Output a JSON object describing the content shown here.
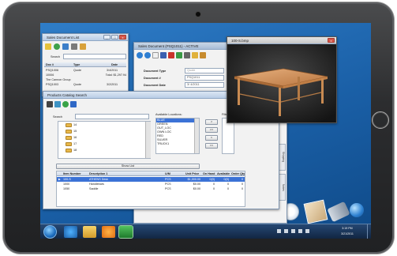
{
  "sales_list": {
    "title": "Sales Document List",
    "search_label": "Search",
    "headers": [
      "Doc #",
      "Type",
      "Date"
    ],
    "rows": [
      {
        "doc": "PSQ1006",
        "type": "Quote",
        "date": "3/4/2011"
      },
      {
        "doc": "10006",
        "type": "",
        "date": "Total: $1,297.94"
      },
      {
        "doc": "The Cannon Group",
        "type": "",
        "date": ""
      },
      {
        "doc": "PSQ1003",
        "type": "Quote",
        "date": "3/2/2011"
      }
    ]
  },
  "sales_doc": {
    "title": "Sales Document (PSQ1011) - ACTIVE",
    "fields": [
      {
        "label": "Document Type",
        "value": "Quote"
      },
      {
        "label": "Document #",
        "value": "PSQ1011"
      },
      {
        "label": "Document Date",
        "value": "3/ 4/2011"
      }
    ],
    "side_tabs": [
      "Shipping",
      "Notes"
    ]
  },
  "catalog": {
    "title": "Products Catalog Search",
    "search_label": "Search",
    "locations_label": "Available Locations:",
    "filters_label": "Filters",
    "tree_items": [
      "14",
      "15",
      "16",
      "17",
      "18"
    ],
    "locations": [
      "BLUE",
      "GREEN",
      "OUT_LOC",
      "OWN LOC",
      "RED",
      "SILVER",
      "TRUCK1"
    ],
    "move_buttons": [
      ">",
      ">>",
      "<",
      "<<"
    ],
    "show_list_label": "Show List",
    "grid_headers": [
      "Item Number",
      "Description 1",
      "U/M",
      "Unit Price",
      "On Hand",
      "Available",
      "Order Qty"
    ],
    "rows": [
      {
        "item": "100-S",
        "desc": "ATHENS Desk",
        "um": "PCS",
        "price": "$1,000.00",
        "onhand": "0(0)",
        "avail": "0(0)",
        "qty": "0"
      },
      {
        "item": "1000",
        "desc": "Handlebars",
        "um": "PCS",
        "price": "$0.00",
        "onhand": "0",
        "avail": "0",
        "qty": "0"
      },
      {
        "item": "1050",
        "desc": "Saddle",
        "um": "PCS",
        "price": "$0.00",
        "onhand": "0",
        "avail": "0",
        "qty": "0"
      }
    ]
  },
  "image_viewer": {
    "title": "100-S.bmp"
  },
  "taskbar": {
    "time": "3:19 PM",
    "date": "3/21/2011"
  },
  "colors": {
    "desktop": "#1a5fa6",
    "selection": "#3b72d6",
    "tablet_bezel": "#2c2d2f"
  }
}
